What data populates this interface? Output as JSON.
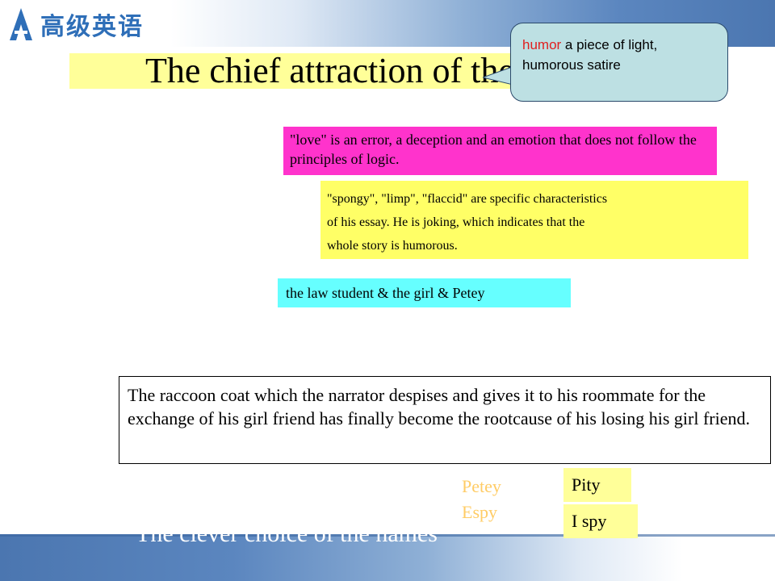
{
  "logo": {
    "text": "高级英语",
    "icon": "book-a-logo-icon"
  },
  "title": "The chief attraction of the story",
  "callout": {
    "keyword": "humor",
    "text": " a piece of light, humorous satire"
  },
  "boxes": {
    "love": "\"love\" is an error, a deception and an emotion that does not follow the principles of logic.",
    "spongy": {
      "line1": "\"spongy\", \"limp\", \"flaccid\" are specific characteristics",
      "line2": " of his essay. He is joking, which indicates that the",
      "line3": "whole story is humorous."
    },
    "law": "the law student & the girl & Petey",
    "coat": "The raccoon coat which the narrator despises and gives it to his roommate for the exchange of his girl friend has finally become the rootcause of his losing his girl friend."
  },
  "names": {
    "petey": "Petey",
    "espy": "Espy",
    "pity": "Pity",
    "ispy": "I spy"
  },
  "footer": {
    "clever": "The clever choice of the names"
  },
  "colors": {
    "title_bg": "#ffff99",
    "callout_bg": "#bde0e3",
    "love_bg": "#ff33cc",
    "spongy_bg": "#ffff66",
    "law_bg": "#66ffff",
    "band": "#4b76b0"
  }
}
